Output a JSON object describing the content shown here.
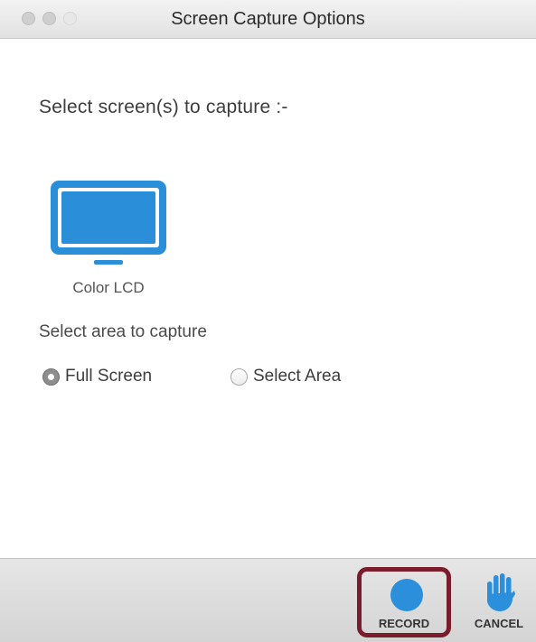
{
  "window": {
    "title": "Screen Capture Options"
  },
  "screens": {
    "heading": "Select screen(s) to capture :-",
    "items": [
      {
        "label": "Color LCD",
        "icon": "monitor-icon"
      }
    ]
  },
  "area": {
    "label": "Select area to capture",
    "options": [
      {
        "label": "Full Screen",
        "selected": true
      },
      {
        "label": "Select Area",
        "selected": false
      }
    ]
  },
  "footer": {
    "record_label": "RECORD",
    "record_icon": "record-icon",
    "cancel_label": "CANCEL",
    "cancel_icon": "hand-stop-icon"
  },
  "colors": {
    "accent": "#2b8fdc",
    "highlight_border": "#7a1c2c"
  }
}
